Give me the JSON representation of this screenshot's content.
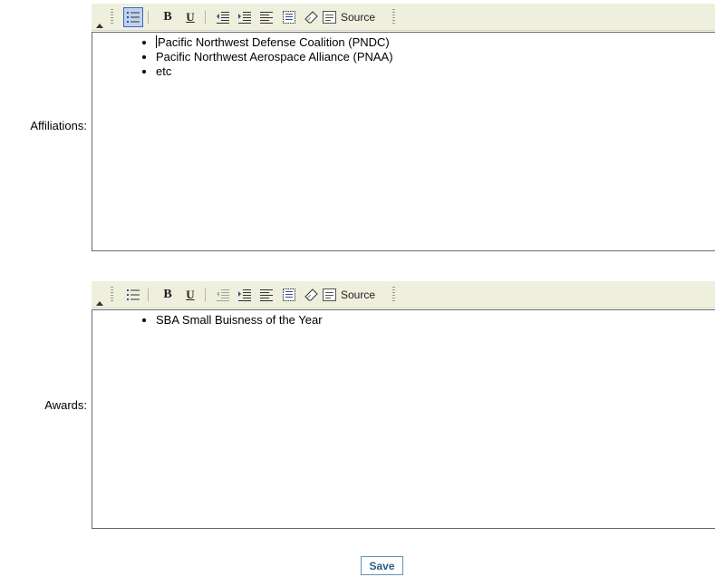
{
  "affiliations": {
    "label": "Affiliations:",
    "items": [
      "Pacific Northwest Defense Coalition (PNDC)",
      "Pacific Northwest Aerospace Alliance (PNAA)",
      "etc"
    ]
  },
  "awards": {
    "label": "Awards:",
    "items": [
      "SBA Small Buisness of the Year"
    ]
  },
  "toolbar": {
    "bold": "B",
    "underline": "U",
    "source_label": "Source"
  },
  "save_label": "Save",
  "colors": {
    "toolbar_bg": "#efefde",
    "active_btn_bg": "#c1d2ee",
    "active_btn_border": "#316ac5",
    "save_text": "#2b5d86",
    "save_border": "#5f94b8"
  }
}
